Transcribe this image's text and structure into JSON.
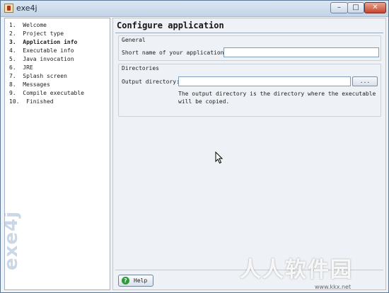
{
  "window": {
    "title": "exe4j",
    "minimize_glyph": "–",
    "maximize_glyph": "□",
    "close_glyph": "✕"
  },
  "sidebar": {
    "brand": "exe4j",
    "steps": [
      {
        "label": "1.  Welcome",
        "active": false
      },
      {
        "label": "2.  Project type",
        "active": false
      },
      {
        "label": "3.  Application info",
        "active": true
      },
      {
        "label": "4.  Executable info",
        "active": false
      },
      {
        "label": "5.  Java invocation",
        "active": false
      },
      {
        "label": "6.  JRE",
        "active": false
      },
      {
        "label": "7.  Splash screen",
        "active": false
      },
      {
        "label": "8.  Messages",
        "active": false
      },
      {
        "label": "9.  Compile executable",
        "active": false
      },
      {
        "label": "10.  Finished",
        "active": false
      }
    ]
  },
  "main": {
    "title": "Configure application",
    "general": {
      "label": "General",
      "short_name_label": "Short name of your application:",
      "short_name_value": ""
    },
    "directories": {
      "label": "Directories",
      "output_label": "Output directory:",
      "output_value": "",
      "browse_label": "...",
      "hint_line1": "The output directory is the directory where the executable",
      "hint_line2": "will be copied."
    },
    "help_label": "Help",
    "help_icon": "?"
  },
  "overlay": {
    "watermark": "人人软件园",
    "watermark_url": "www.kkx.net"
  }
}
